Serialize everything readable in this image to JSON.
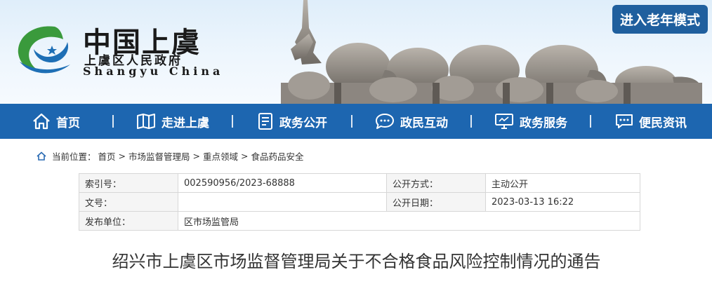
{
  "header": {
    "site_name": "中国上虞",
    "site_subtitle": "上虞区人民政府",
    "site_english": "Shangyu  China",
    "elderly_mode_label": "进入老年模式"
  },
  "nav": {
    "items": [
      {
        "label": "首页",
        "icon": "home-icon"
      },
      {
        "label": "走进上虞",
        "icon": "book-icon"
      },
      {
        "label": "政务公开",
        "icon": "document-icon"
      },
      {
        "label": "政民互动",
        "icon": "chat-icon"
      },
      {
        "label": "政务服务",
        "icon": "monitor-icon"
      },
      {
        "label": "便民资讯",
        "icon": "message-icon"
      }
    ]
  },
  "breadcrumb": {
    "prefix": "当前位置：",
    "items": [
      "首页",
      "市场监督管理局",
      "重点领域",
      "食品药品安全"
    ],
    "separator": ">"
  },
  "info": {
    "index_label": "索引号：",
    "index_value": "002590956/2023-68888",
    "disclosure_label": "公开方式：",
    "disclosure_value": "主动公开",
    "docno_label": "文号：",
    "docno_value": "",
    "date_label": "公开日期：",
    "date_value": "2023-03-13 16:22",
    "publisher_label": "发布单位：",
    "publisher_value": "区市场监管局"
  },
  "article": {
    "title": "绍兴市上虞区市场监督管理局关于不合格食品风险控制情况的通告"
  },
  "colors": {
    "nav_bg": "#1d66b0",
    "elderly_btn_bg": "#1f5f9e"
  }
}
